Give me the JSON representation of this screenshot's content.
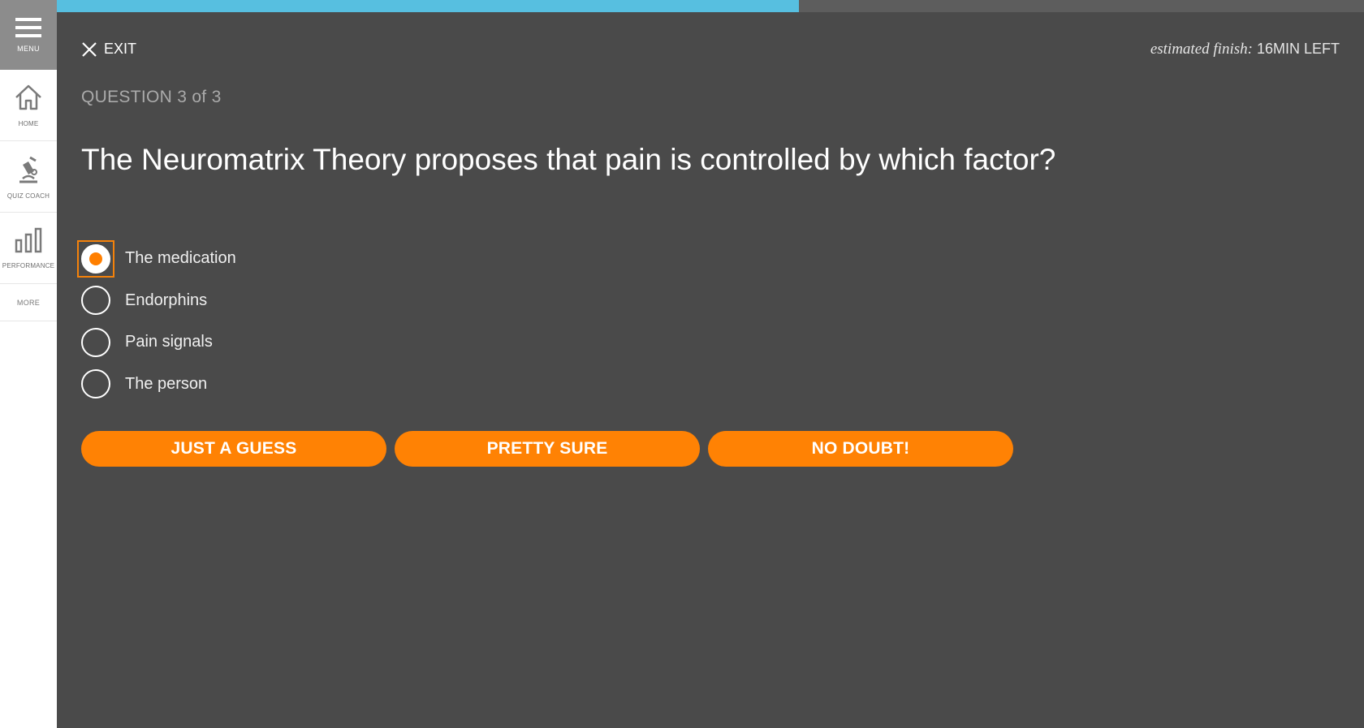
{
  "sidebar": {
    "menu_label": "MENU",
    "items": [
      {
        "label": "HOME",
        "icon": "home-icon"
      },
      {
        "label": "QUIZ COACH",
        "icon": "quiz-coach-icon"
      },
      {
        "label": "PERFORMANCE",
        "icon": "bar-chart-icon"
      }
    ],
    "more_label": "MORE"
  },
  "progress": {
    "fraction": 0.568,
    "color": "#57bfe0"
  },
  "header": {
    "exit_label": "EXIT",
    "estimate_prefix": "estimated finish:",
    "estimate_value": "16MIN LEFT"
  },
  "question": {
    "counter": "QUESTION 3 of 3",
    "text": "The Neuromatrix Theory proposes that pain is controlled by which factor?",
    "options": [
      {
        "label": "The medication",
        "selected": true
      },
      {
        "label": "Endorphins",
        "selected": false
      },
      {
        "label": "Pain signals",
        "selected": false
      },
      {
        "label": "The person",
        "selected": false
      }
    ]
  },
  "confidence_buttons": [
    "JUST A GUESS",
    "PRETTY SURE",
    "NO DOUBT!"
  ],
  "colors": {
    "accent": "#ff8204",
    "background": "#4a4a4a",
    "sidebar_menu": "#8c8c8c"
  }
}
